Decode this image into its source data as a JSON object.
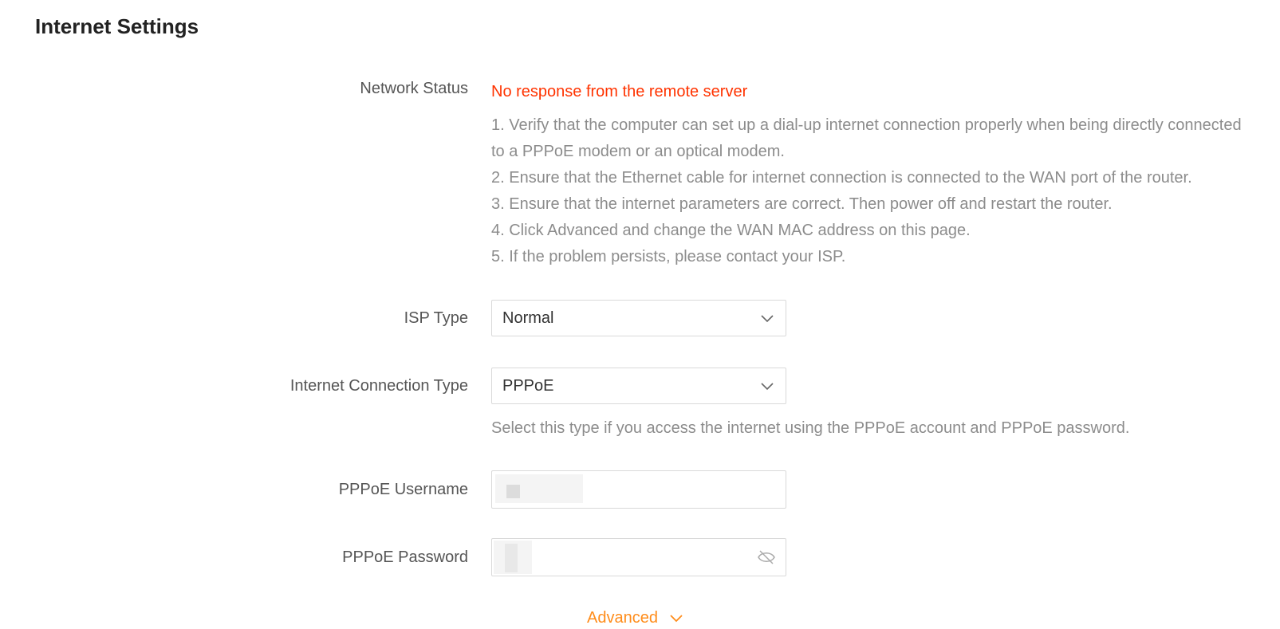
{
  "page": {
    "title": "Internet Settings"
  },
  "network_status": {
    "label": "Network Status",
    "value": "No response from the remote server",
    "status_color": "#ff3300",
    "tips": [
      "1. Verify that the computer can set up a dial-up internet connection properly when being directly connected to a PPPoE modem or an optical modem.",
      "2. Ensure that the Ethernet cable for internet connection is connected to the WAN port of the router.",
      "3. Ensure that the internet parameters are correct. Then power off and restart the router.",
      "4. Click Advanced and change the WAN MAC address on this page.",
      "5. If the problem persists, please contact your ISP."
    ]
  },
  "isp_type": {
    "label": "ISP Type",
    "value": "Normal",
    "icon": "chevron-down-icon"
  },
  "connection_type": {
    "label": "Internet Connection Type",
    "value": "PPPoE",
    "icon": "chevron-down-icon",
    "help": "Select this type if you access the internet using the PPPoE account and PPPoE password."
  },
  "pppoe_username": {
    "label": "PPPoE Username",
    "value": ""
  },
  "pppoe_password": {
    "label": "PPPoE Password",
    "value": "",
    "icon": "eye-hidden-icon"
  },
  "advanced": {
    "label": "Advanced",
    "color": "#ff8c1a",
    "icon": "chevron-down-icon"
  }
}
